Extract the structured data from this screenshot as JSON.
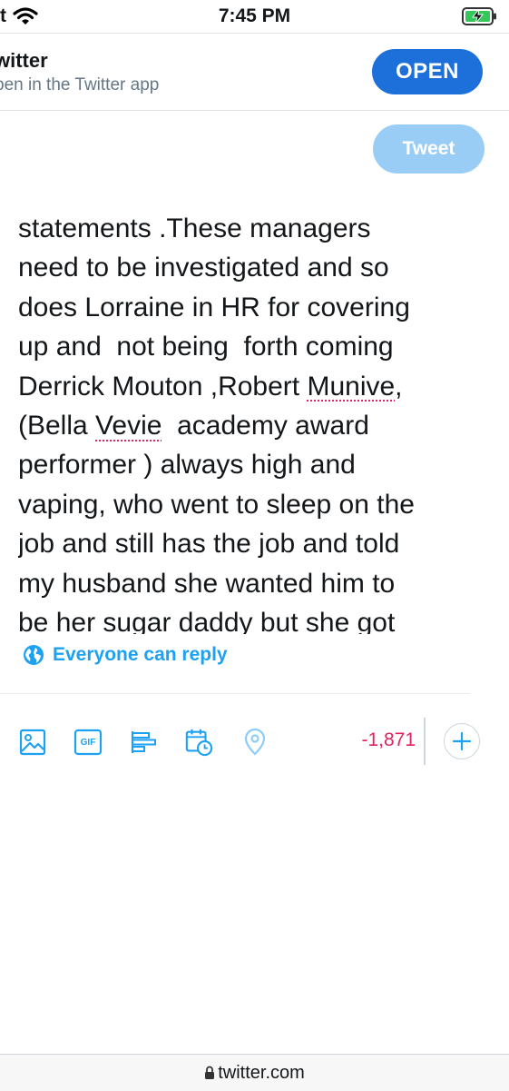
{
  "status_bar": {
    "carrier": "t",
    "time": "7:45 PM"
  },
  "app_banner": {
    "title": "witter",
    "subtitle": "pen in the Twitter app",
    "open_label": "OPEN"
  },
  "composer": {
    "tweet_label": "Tweet",
    "lines": [
      "statements .These managers",
      "need to be investigated and so",
      "does Lorraine in HR for covering",
      "up and  not being  forth coming",
      "Derrick Mouton ,Robert ",
      "Munive",
      ",",
      "(Bella ",
      "Vevie",
      "  academy award",
      "performer ) always high and",
      "vaping, who went to sleep on the",
      "job and still has the job and told",
      "my husband she wanted him to",
      "be her sugar daddy but she got"
    ],
    "reply_setting": "Everyone can reply",
    "char_count": "-1,871"
  },
  "toolbar": {
    "icons": [
      "image-icon",
      "gif-icon",
      "poll-icon",
      "schedule-icon",
      "location-icon",
      "add-icon"
    ],
    "gif_label": "GIF"
  },
  "browser": {
    "url": "twitter.com"
  },
  "colors": {
    "accent": "#1da1f2",
    "open_button": "#1d6fd9",
    "tweet_disabled": "#99cdf5",
    "over_limit": "#e0245e"
  }
}
